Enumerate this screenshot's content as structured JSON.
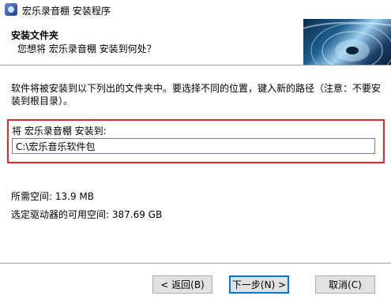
{
  "window": {
    "title": "宏乐录音棚 安装程序",
    "icon": "installer-icon"
  },
  "header": {
    "title": "安装文件夹",
    "subtitle": "您想将 宏乐录音棚 安装到何处？"
  },
  "body": {
    "description": "软件将被安装到以下列出的文件夹中。要选择不同的位置，键入新的路径（注意：不要安装到根目录）。",
    "group_label": "将 宏乐录音棚 安装到:",
    "install_path": "C:\\宏乐音乐软件包",
    "space_required": "所需空间: 13.9 MB",
    "space_available": "选定驱动器的可用空间: 387.69 GB"
  },
  "buttons": {
    "back": "< 返回(B)",
    "next": "下一步(N) >",
    "cancel": "取消(C)"
  },
  "colors": {
    "highlight_border": "#e0282e",
    "default_button_border": "#0078d7"
  }
}
